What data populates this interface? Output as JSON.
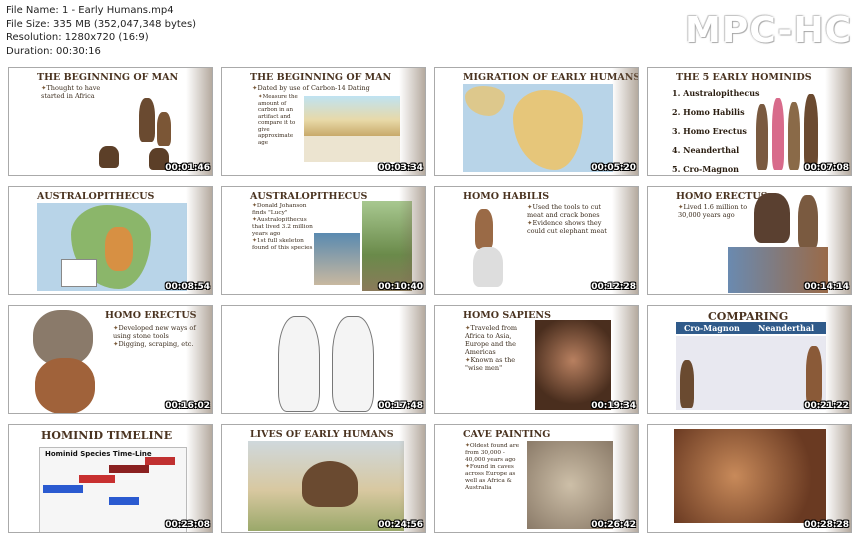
{
  "file_info": {
    "name": "File Name: 1 - Early Humans.mp4",
    "size": "File Size: 335 MB (352,047,348 bytes)",
    "resolution": "Resolution: 1280x720 (16:9)",
    "duration": "Duration: 00:30:16"
  },
  "brand": "MPC-HC",
  "thumbnails": [
    {
      "title": "THE BEGINNING OF MAN",
      "bullets": [
        "Thought to have started in Africa"
      ],
      "time": "00:01:46"
    },
    {
      "title": "THE BEGINNING OF MAN",
      "bullets": [
        "Dated by use of Carbon-14 Dating",
        "Measure the amount of carbon in an artifact and compare it to give approximate age"
      ],
      "time": "00:03:34"
    },
    {
      "title": "MIGRATION OF EARLY HUMANS",
      "bullets": [],
      "time": "00:05:20"
    },
    {
      "title": "THE 5 EARLY HOMINIDS",
      "list": [
        "Australopithecus",
        "Homo Habilis",
        "Homo Erectus",
        "Neanderthal",
        "Cro-Magnon"
      ],
      "time": "00:07:08"
    },
    {
      "title": "AUSTRALOPITHECUS",
      "bullets": [],
      "time": "00:08:54"
    },
    {
      "title": "AUSTRALOPITHECUS",
      "bullets": [
        "Donald Johanson finds \"Lucy\"",
        "Australopithecus that lived 3.2 million years ago",
        "1st full skeleton found of this species"
      ],
      "time": "00:10:40"
    },
    {
      "title": "HOMO HABILIS",
      "bullets": [
        "Used the tools to cut meat and crack bones",
        "Evidence shows they could cut elephant meat"
      ],
      "time": "00:12:28"
    },
    {
      "title": "HOMO ERECTUS",
      "bullets": [
        "Lived 1.6 million to 30,000 years ago"
      ],
      "time": "00:14:14"
    },
    {
      "title": "HOMO ERECTUS",
      "bullets": [
        "Developed new ways of using stone tools",
        "Digging, scraping, etc."
      ],
      "time": "00:16:02"
    },
    {
      "title": "",
      "bullets": [],
      "time": "00:17:48"
    },
    {
      "title": "HOMO SAPIENS",
      "bullets": [
        "Traveled from Africa to Asia, Europe and the Americas",
        "Known as the \"wise men\""
      ],
      "time": "00:19:34"
    },
    {
      "title": "COMPARING",
      "subtitle_left": "Cro-Magnon",
      "subtitle_right": "Neanderthal",
      "time": "00:21:22"
    },
    {
      "title": "HOMINID TIMELINE",
      "subtitle": "Hominid Species Time-Line",
      "time": "00:23:08"
    },
    {
      "title": "LIVES OF EARLY HUMANS",
      "bullets": [],
      "time": "00:24:56"
    },
    {
      "title": "CAVE PAINTING",
      "bullets": [
        "Oldest found are from 30,000 - 40,000 years ago",
        "Found in caves across Europe as well as Africa & Australia"
      ],
      "time": "00:26:42"
    },
    {
      "title": "",
      "bullets": [],
      "time": "00:28:28"
    }
  ]
}
